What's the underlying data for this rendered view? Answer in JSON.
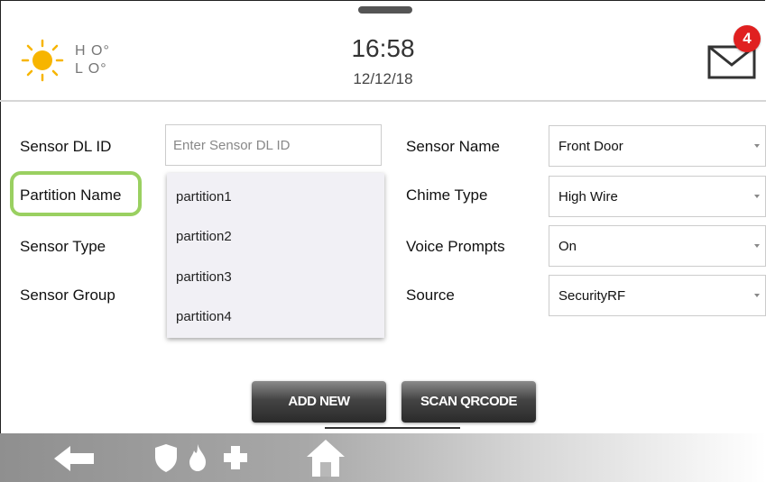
{
  "header": {
    "weather": {
      "hi": "H O°",
      "lo": "L O°",
      "icon": "sun-icon"
    },
    "time": "16:58",
    "date": "12/12/18",
    "messages": {
      "icon": "envelope-icon",
      "badge": "4"
    }
  },
  "form": {
    "left": [
      {
        "label": "Sensor DL ID"
      },
      {
        "label": "Partition Name"
      },
      {
        "label": "Sensor Type"
      },
      {
        "label": "Sensor Group"
      }
    ],
    "dl_id_placeholder": "Enter Sensor DL ID",
    "right": [
      {
        "label": "Sensor Name",
        "value": "Front Door"
      },
      {
        "label": "Chime Type",
        "value": "High Wire"
      },
      {
        "label": "Voice Prompts",
        "value": "On"
      },
      {
        "label": "Source",
        "value": "SecurityRF"
      }
    ],
    "partition_options": [
      "partition1",
      "partition2",
      "partition3",
      "partition4"
    ]
  },
  "buttons": {
    "add_new": "ADD NEW",
    "scan_qrcode": "SCAN QRCODE"
  },
  "bottom_nav": {
    "icons": [
      "back-arrow-icon",
      "shield-icon",
      "fire-icon",
      "plus-icon",
      "home-icon"
    ]
  },
  "colors": {
    "highlight": "#9ad061",
    "badge": "#e02020",
    "sun": "#f7b500"
  }
}
